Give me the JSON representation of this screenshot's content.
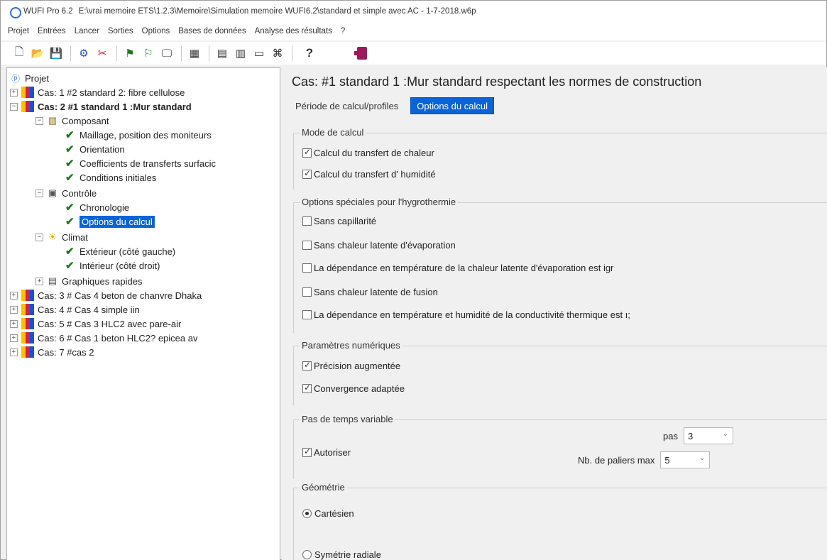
{
  "window": {
    "app_name": "WUFI Pro 6.2",
    "file_path": "E:\\vrai memoire ETS\\1.2.3\\Memoire\\Simulation memoire WUFI6.2\\standard et simple avec AC - 1-7-2018.w6p"
  },
  "menu": [
    "Projet",
    "Entrées",
    "Lancer",
    "Sorties",
    "Options",
    "Bases de données",
    "Analyse des résultats",
    "?"
  ],
  "toolbar": {
    "help_label": "?"
  },
  "tree": {
    "root": "Projet",
    "case1": "Cas: 1 #2 standard 2: fibre cellulose",
    "case2": "Cas: 2 #1 standard  1 :Mur standard",
    "composant": "Composant",
    "maillage": "Maillage, position des moniteurs",
    "orientation": "Orientation",
    "coefficients": "Coefficients de transferts surfacic",
    "conditions": "Conditions initiales",
    "controle": "Contrôle",
    "chronologie": "Chronologie",
    "options_calcul": "Options du calcul",
    "climat": "Climat",
    "exterieur": "Extérieur (côté gauche)",
    "interieur": "Intérieur (côté droit)",
    "graphiques": "Graphiques rapides",
    "case3": "Cas: 3 # Cas 4 beton de chanvre Dhaka",
    "case4": "Cas: 4 # Cas 4 simple iin",
    "case5": "Cas: 5 # Cas 3  HLC2 avec pare-air",
    "case6": "Cas: 6 # Cas 1 beton HLC2? epicea  av",
    "case7": "Cas: 7 #cas 2"
  },
  "main": {
    "case_title": "Cas:  #1 standard  1 :Mur standard respectant les normes de construction",
    "tabs": [
      "Période de calcul/profiles",
      "Options du calcul"
    ],
    "mode_calcul": {
      "legend": "Mode de calcul",
      "heat": "Calcul du transfert de chaleur",
      "moisture": "Calcul du transfert d' humidité"
    },
    "options_speciales": {
      "legend": "Options spéciales pour l'hygrothermie",
      "capillarite": "Sans capillarité",
      "chaleur_evap": "Sans chaleur latente d'évaporation",
      "dependance_evap": "La dépendance en température de la chaleur latente d'évaporation est igr",
      "chaleur_fusion": "Sans chaleur latente de fusion",
      "dependance_cond": "La dépendance en température et humidité de la conductivité thermique est ı;"
    },
    "parametres": {
      "legend": "Paramètres numériques",
      "precision": "Précision augmentée",
      "convergence": "Convergence adaptée"
    },
    "pas_temps": {
      "legend": "Pas de temps variable",
      "autoriser": "Autoriser",
      "pas_label": "pas",
      "pas_value": "3",
      "paliers_label": "Nb. de paliers max",
      "paliers_value": "5"
    },
    "geometrie": {
      "legend": "Géométrie",
      "cartesien": "Cartésien",
      "radiale": "Symétrie radiale"
    }
  }
}
